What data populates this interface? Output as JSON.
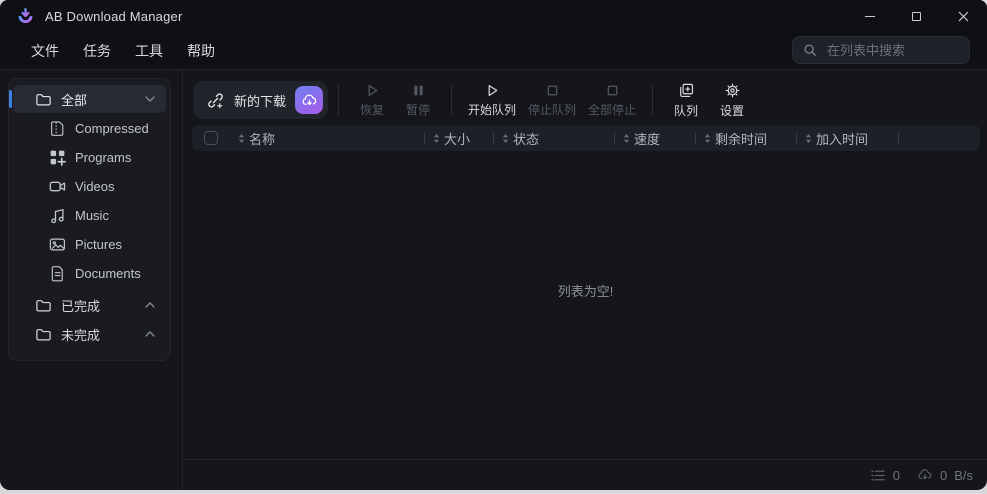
{
  "titlebar": {
    "title": "AB Download Manager"
  },
  "menubar": {
    "items": [
      {
        "label": "文件"
      },
      {
        "label": "任务"
      },
      {
        "label": "工具"
      },
      {
        "label": "帮助"
      }
    ]
  },
  "search": {
    "placeholder": "在列表中搜索"
  },
  "sidebar": {
    "items": [
      {
        "label": "全部"
      },
      {
        "label": "Compressed"
      },
      {
        "label": "Programs"
      },
      {
        "label": "Videos"
      },
      {
        "label": "Music"
      },
      {
        "label": "Pictures"
      },
      {
        "label": "Documents"
      },
      {
        "label": "已完成"
      },
      {
        "label": "未完成"
      }
    ]
  },
  "toolbar": {
    "new_download": {
      "label": "新的下载"
    },
    "actions": [
      {
        "label": "恢复",
        "enabled": false
      },
      {
        "label": "暂停",
        "enabled": false
      },
      {
        "label": "开始队列",
        "enabled": true
      },
      {
        "label": "停止队列",
        "enabled": false
      },
      {
        "label": "全部停止",
        "enabled": false
      },
      {
        "label": "队列",
        "enabled": true
      },
      {
        "label": "设置",
        "enabled": true
      }
    ]
  },
  "table": {
    "columns": [
      {
        "label": "名称"
      },
      {
        "label": "大小"
      },
      {
        "label": "状态"
      },
      {
        "label": "速度"
      },
      {
        "label": "剩余时间"
      },
      {
        "label": "加入时间"
      }
    ],
    "empty_text": "列表为空!"
  },
  "statusbar": {
    "queue_count": "0",
    "speed_value": "0",
    "speed_unit": "B/s"
  },
  "colors": {
    "accent_blue": "#3f7fe0",
    "button_gradient_start": "#7080f2",
    "button_gradient_end": "#a75ae8",
    "window_bg": "#14161b",
    "header_bg": "#0f1014"
  }
}
